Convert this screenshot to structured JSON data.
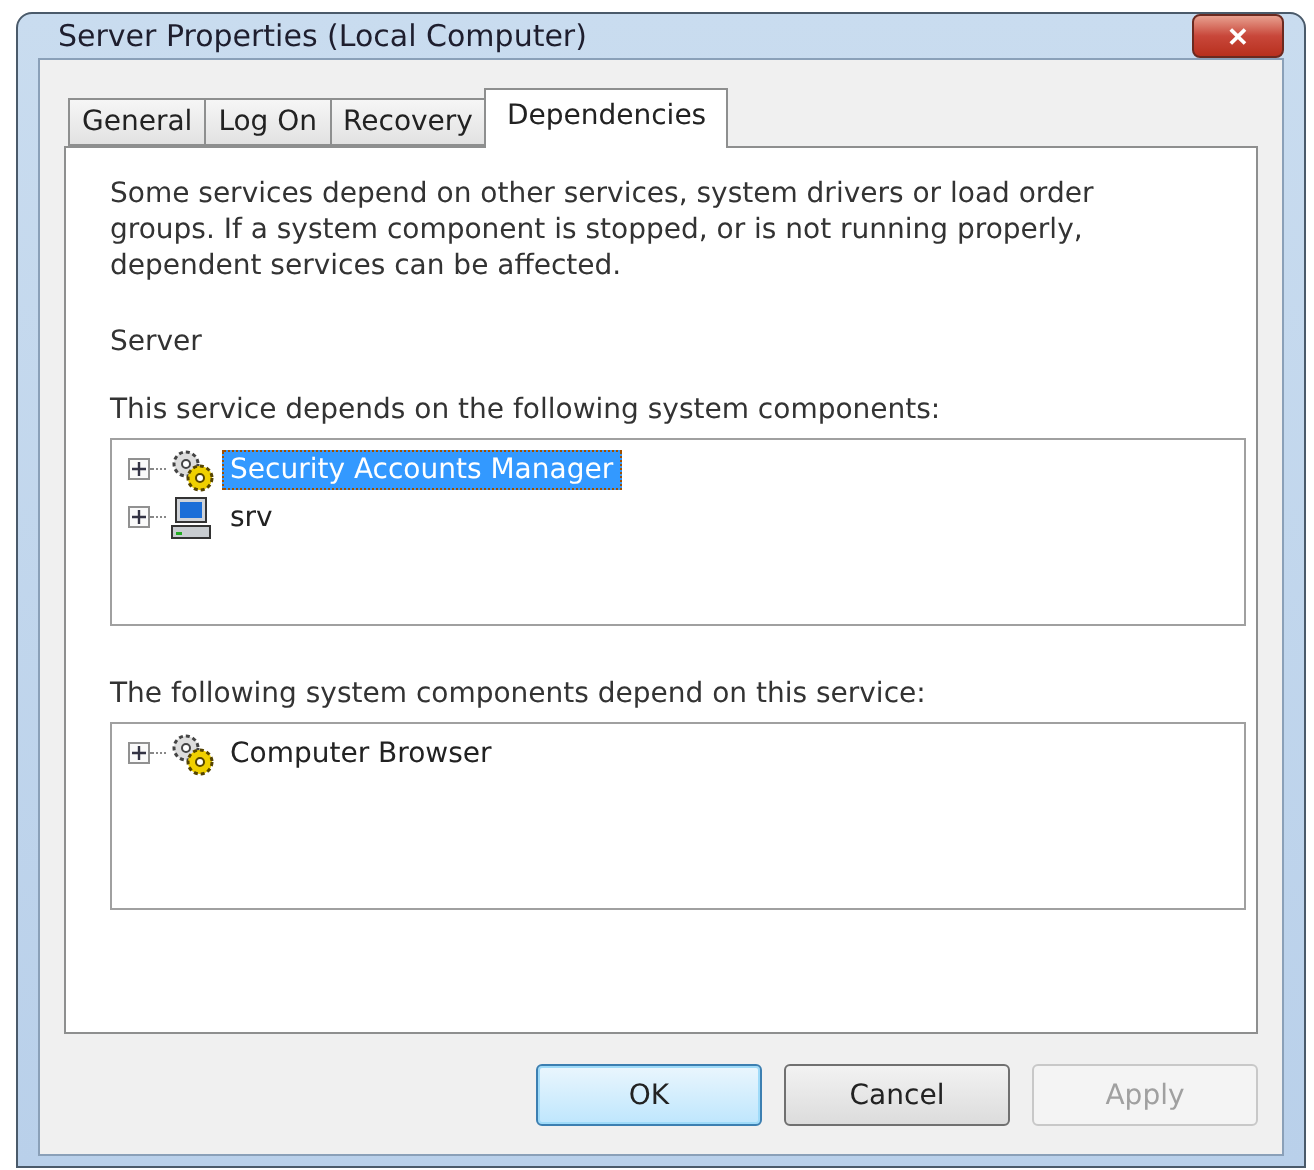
{
  "window": {
    "title": "Server Properties (Local Computer)",
    "close_label": "✕"
  },
  "tabs": [
    {
      "label": "General",
      "selected": false
    },
    {
      "label": "Log On",
      "selected": false
    },
    {
      "label": "Recovery",
      "selected": false
    },
    {
      "label": "Dependencies",
      "selected": true
    }
  ],
  "description": "Some services depend on other services, system drivers or load order groups. If a system component is stopped, or is not running properly, dependent services can be affected.",
  "service_name": "Server",
  "depends_on": {
    "label": "This service depends on the following system components:",
    "items": [
      {
        "label": "Security Accounts Manager",
        "kind": "service",
        "selected": true,
        "expanded": false
      },
      {
        "label": "srv",
        "kind": "driver",
        "selected": false,
        "expanded": false
      }
    ]
  },
  "dependents": {
    "label": "The following system components depend on this service:",
    "items": [
      {
        "label": "Computer Browser",
        "kind": "service",
        "selected": false,
        "expanded": false
      }
    ]
  },
  "buttons": [
    {
      "label": "OK",
      "default": true,
      "disabled": false
    },
    {
      "label": "Cancel",
      "default": false,
      "disabled": false
    },
    {
      "label": "Apply",
      "default": false,
      "disabled": true
    }
  ]
}
